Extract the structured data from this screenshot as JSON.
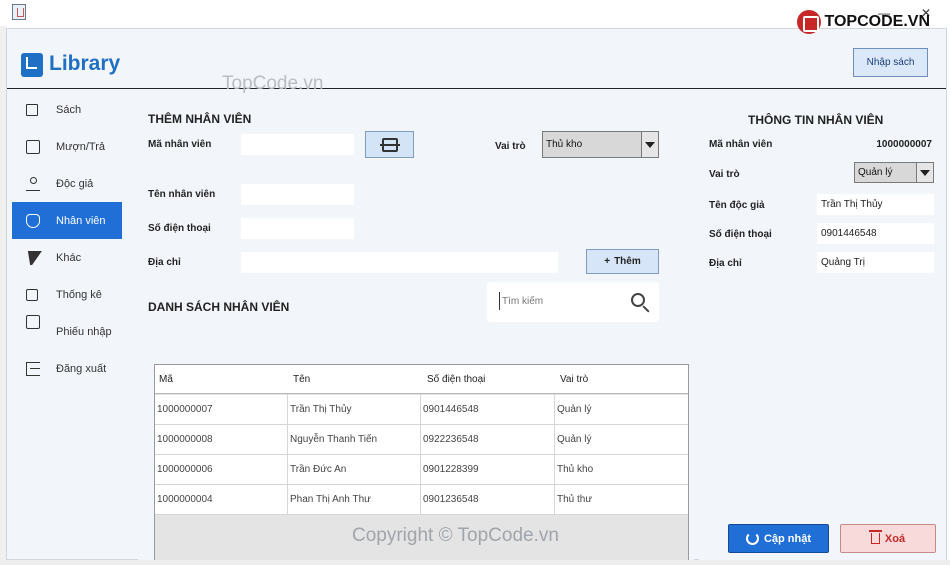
{
  "window": {
    "minimize": "—",
    "close": "✕"
  },
  "brand": {
    "name": "TOPCODE.VN"
  },
  "watermark": {
    "top": "TopCode.vn",
    "bottom": "Copyright © TopCode.vn"
  },
  "header": {
    "logo": "Library",
    "import_button": "Nhập sách"
  },
  "sidebar": {
    "items": [
      {
        "label": "Sách",
        "icon": "grid-icon",
        "active": false
      },
      {
        "label": "Mượn/Trả",
        "icon": "arrow-out-icon",
        "active": false
      },
      {
        "label": "Độc giả",
        "icon": "readers-icon",
        "active": false
      },
      {
        "label": "Nhân viên",
        "icon": "employee-badge-icon",
        "active": true
      },
      {
        "label": "Khác",
        "icon": "bolt-icon",
        "active": false
      },
      {
        "label": "Thống kê",
        "icon": "stats-grid-icon",
        "active": false
      },
      {
        "label": "Phiếu nhập",
        "icon": "ticket-icon",
        "active": false
      },
      {
        "label": "Đăng xuất",
        "icon": "logout-icon",
        "active": false
      }
    ]
  },
  "add_form": {
    "title": "THÊM NHÂN VIÊN",
    "id_label": "Mã nhân viên",
    "id_value": "",
    "role_label": "Vai trò",
    "role_value": "Thủ kho",
    "name_label": "Tên nhân viên",
    "name_value": "",
    "phone_label": "Số điện thoại",
    "phone_value": "",
    "address_label": "Địa chỉ",
    "address_value": "",
    "add_button": "Thêm"
  },
  "list": {
    "title": "DANH SÁCH NHÂN VIÊN",
    "search_placeholder": "Tìm kiếm",
    "columns": [
      "Mã",
      "Tên",
      "Số điện thoại",
      "Vai trò"
    ],
    "rows": [
      [
        "1000000007",
        "Trần Thị Thủy",
        "0901446548",
        "Quản lý"
      ],
      [
        "1000000008",
        "Nguyễn Thanh Tiến",
        "0922236548",
        "Quản lý"
      ],
      [
        "1000000006",
        "Trần Đức An",
        "0901228399",
        "Thủ kho"
      ],
      [
        "1000000004",
        "Phan Thị Anh Thư",
        "0901236548",
        "Thủ thư"
      ]
    ]
  },
  "info": {
    "title": "THÔNG TIN NHÂN VIÊN",
    "id_label": "Mã nhân viên",
    "id_value": "1000000007",
    "role_label": "Vai trò",
    "role_value": "Quản lý",
    "name_label": "Tên độc giả",
    "name_value": "Trần Thị Thủy",
    "phone_label": "Số điện thoại",
    "phone_value": "0901446548",
    "address_label": "Địa chỉ",
    "address_value": "Quảng Trị",
    "update_button": "Cập nhật",
    "delete_button": "Xoá"
  },
  "colors": {
    "accent": "#1f6fd6",
    "danger": "#c62828",
    "background": "#f2f5f9"
  }
}
